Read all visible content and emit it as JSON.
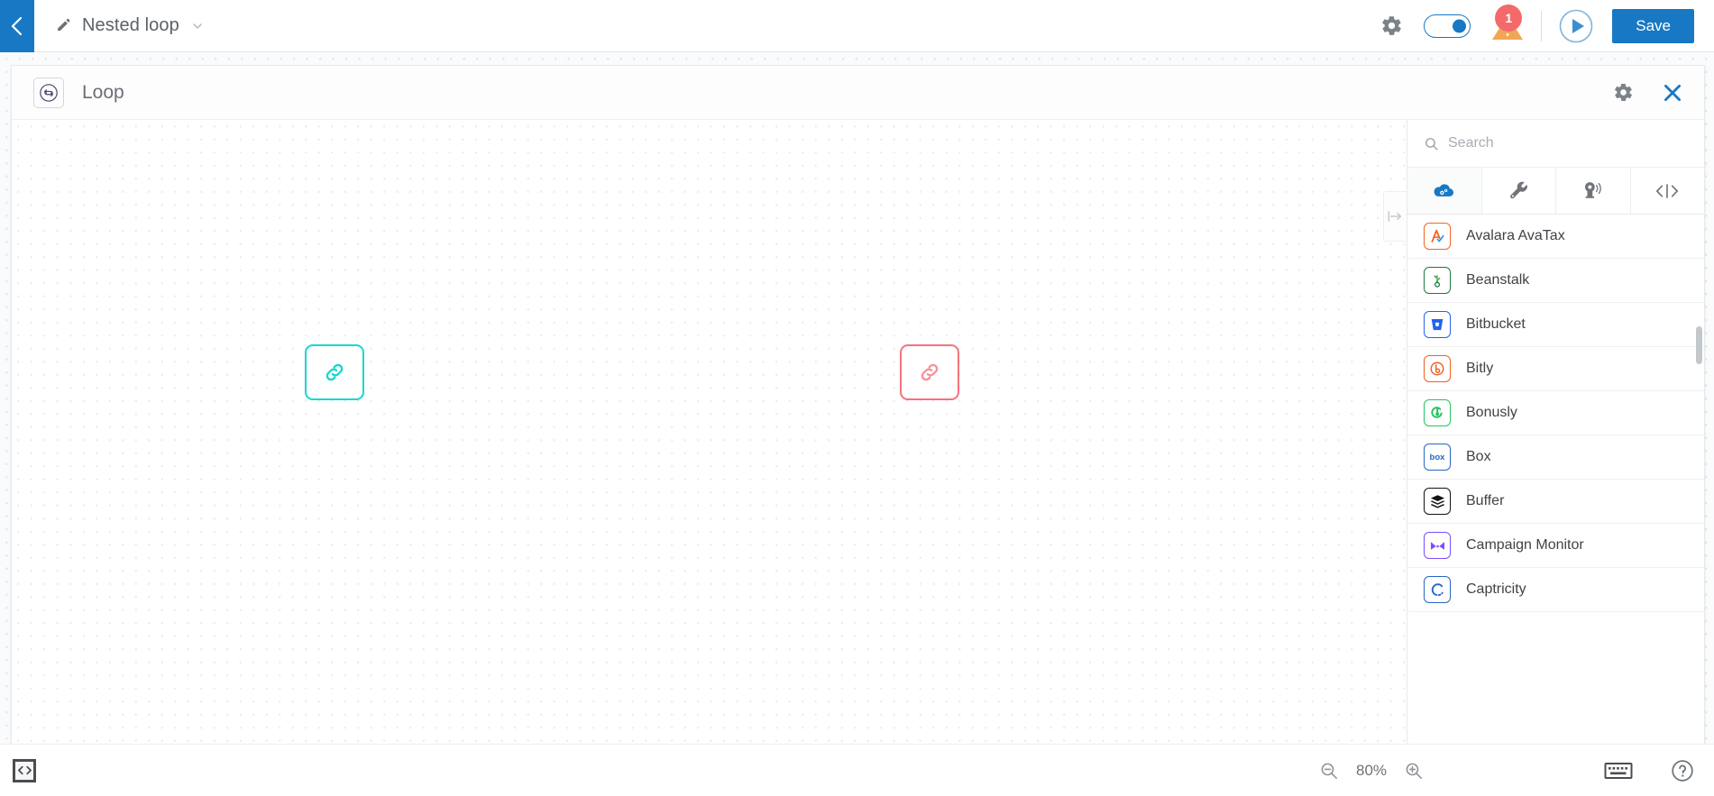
{
  "topbar": {
    "back_icon": "chevron-left-icon",
    "edit_icon": "pencil-icon",
    "workflow_title": "Nested loop",
    "caret_icon": "chevron-down-icon",
    "settings_icon": "gear-icon",
    "toggle_state": "on",
    "warning_count": "1",
    "warning_icon": "warning-triangle-icon",
    "run_icon": "play-circle-icon",
    "save_label": "Save",
    "accent_blue": "#1878c4",
    "warning_red": "#f46a6a",
    "warning_orange": "#f3a556"
  },
  "loop_panel": {
    "icon": "loop-sync-icon",
    "title": "Loop",
    "settings_icon": "gear-icon",
    "close_icon": "close-x-icon"
  },
  "canvas": {
    "zoom_percent": "80%",
    "nodes": [
      {
        "name": "loop-start-node",
        "icon": "chain-link-icon",
        "color": "#17d7cf"
      },
      {
        "name": "loop-end-node",
        "icon": "chain-link-icon",
        "color": "#f4737e"
      }
    ],
    "panel_handle_icon": "arrow-right-collapse-icon"
  },
  "app_panel": {
    "search": {
      "placeholder": "Search",
      "value": "",
      "icon": "search-icon"
    },
    "tabs": [
      {
        "name": "tab-apps",
        "icon": "cloud-apps-icon",
        "active": true
      },
      {
        "name": "tab-tools",
        "icon": "wrench-icon",
        "active": false
      },
      {
        "name": "tab-triggers",
        "icon": "beacon-location-icon",
        "active": false
      },
      {
        "name": "tab-code",
        "icon": "code-brackets-icon",
        "active": false
      }
    ],
    "apps": [
      {
        "label": "Avalara AvaTax",
        "icon": "avalara-avatax-icon",
        "color": "#f26522"
      },
      {
        "label": "Beanstalk",
        "icon": "beanstalk-icon",
        "color": "#1f7a3d"
      },
      {
        "label": "Bitbucket",
        "icon": "bitbucket-icon",
        "color": "#2563eb"
      },
      {
        "label": "Bitly",
        "icon": "bitly-icon",
        "color": "#ee6123"
      },
      {
        "label": "Bonusly",
        "icon": "bonusly-icon",
        "color": "#22c55e"
      },
      {
        "label": "Box",
        "icon": "box-icon",
        "color": "#2566c4"
      },
      {
        "label": "Buffer",
        "icon": "buffer-icon",
        "color": "#131313"
      },
      {
        "label": "Campaign Monitor",
        "icon": "campaign-monitor-icon",
        "color": "#7c4dff"
      },
      {
        "label": "Captricity",
        "icon": "captricity-icon",
        "color": "#2566c4"
      }
    ]
  },
  "bottombar": {
    "code_toggle_icon": "code-brackets-icon",
    "zoom_out_icon": "zoom-out-icon",
    "zoom_level": "80%",
    "zoom_in_icon": "zoom-in-icon",
    "keyboard_icon": "keyboard-icon",
    "help_icon": "help-circle-icon"
  }
}
